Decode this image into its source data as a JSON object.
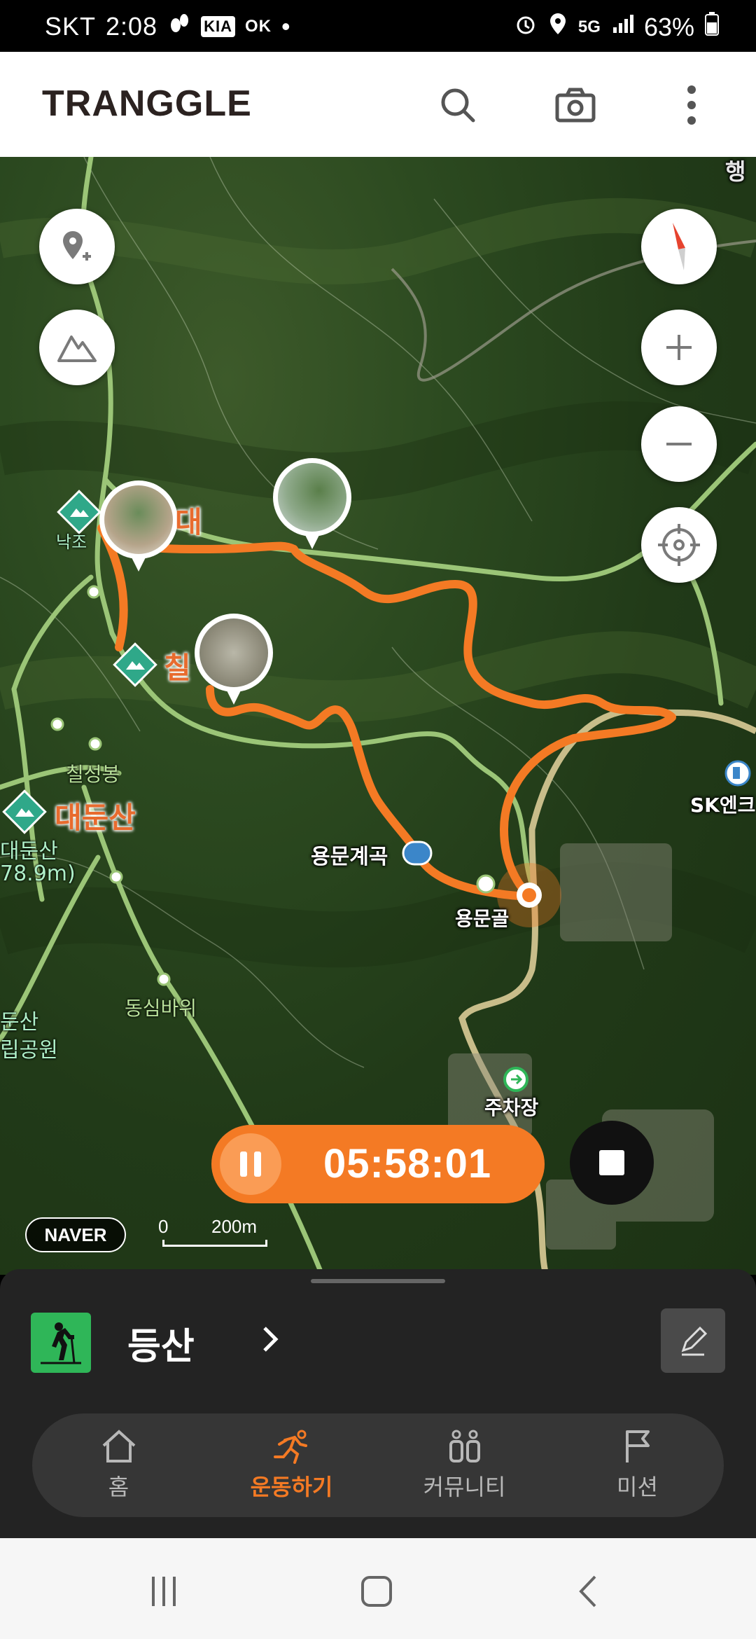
{
  "status_bar": {
    "carrier": "SKT",
    "time": "2:08",
    "battery": "63%",
    "network": "5G",
    "icons": [
      "footprint-icon",
      "kia-connect-icon",
      "ok-cashbag-icon",
      "dot-icon",
      "alarm-icon",
      "location-icon",
      "network-icon",
      "signal-icon",
      "battery-icon"
    ]
  },
  "app_bar": {
    "logo": "TRANGGLE",
    "actions": [
      "search-icon",
      "camera-icon",
      "more-vert-icon"
    ]
  },
  "map": {
    "labels": {
      "peak_top": "대",
      "peak_chil": "칠",
      "chilseongbong": "칠성봉",
      "daedunsan": "대둔산",
      "daedunsan_partial": "대둔산",
      "elevation_partial": "78.9m)",
      "park_partial_1": "둔산",
      "park_partial_2": "립공원",
      "yongmun_valley": "용문계곡",
      "yongmungol": "용문골",
      "dongsim_rock": "동심바위",
      "parking": "주차장",
      "sk_energy": "SK엔크",
      "nakjo_partial": "낙조",
      "top_right_partial": "행"
    },
    "buttons": [
      "add-pin-icon",
      "mountain-icon",
      "compass-icon",
      "zoom-in-icon",
      "zoom-out-icon",
      "locate-icon"
    ],
    "naver": "NAVER",
    "scale_zero": "0",
    "scale_label": "200m",
    "track_color": "#f47a24"
  },
  "timer": {
    "time": "05:58:01"
  },
  "activity": {
    "name": "등산",
    "icon": "hiking-icon",
    "color": "#2fb658"
  },
  "tabs": [
    {
      "label": "홈",
      "icon": "home-icon",
      "active": false
    },
    {
      "label": "운동하기",
      "icon": "running-icon",
      "active": true
    },
    {
      "label": "커뮤니티",
      "icon": "community-icon",
      "active": false
    },
    {
      "label": "미션",
      "icon": "flag-icon",
      "active": false
    }
  ],
  "system_nav": [
    "recents-icon",
    "home-button-icon",
    "back-icon"
  ]
}
